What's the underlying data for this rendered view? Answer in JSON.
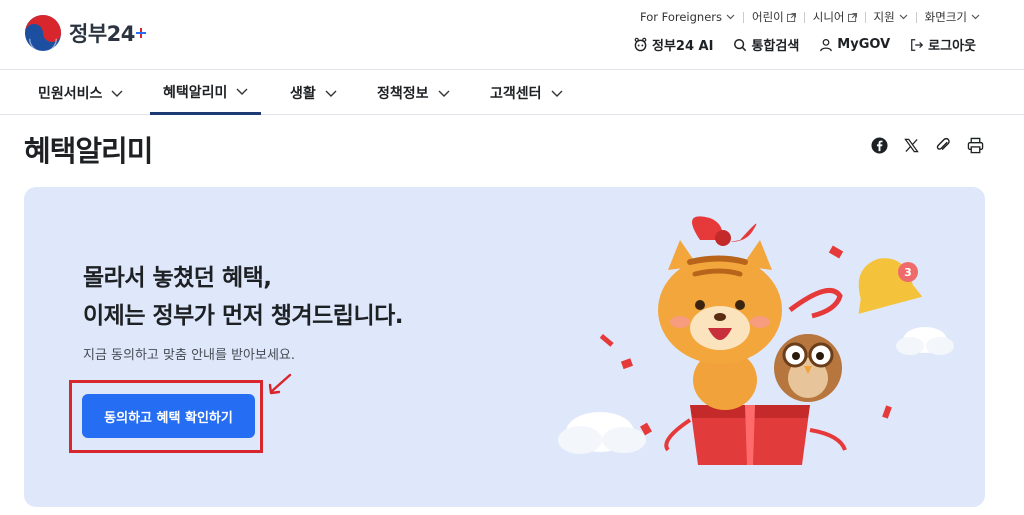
{
  "header": {
    "logo": {
      "text": "정부24",
      "emblem_icon": "taegeuk-emblem-icon"
    },
    "utility": [
      {
        "label": "For Foreigners",
        "icon": "chevron-down-icon"
      },
      {
        "label": "어린이",
        "icon": "external-link-icon"
      },
      {
        "label": "시니어",
        "icon": "external-link-icon"
      },
      {
        "label": "지원",
        "icon": "chevron-down-icon"
      },
      {
        "label": "화면크기",
        "icon": "chevron-down-icon"
      }
    ],
    "main_links": [
      {
        "label": "정부24 AI",
        "icon": "ai-bot-icon"
      },
      {
        "label": "통합검색",
        "icon": "search-icon"
      },
      {
        "label": "MyGOV",
        "icon": "user-icon"
      },
      {
        "label": "로그아웃",
        "icon": "logout-icon"
      }
    ]
  },
  "gnb": {
    "items": [
      {
        "label": "민원서비스",
        "active": false
      },
      {
        "label": "혜택알리미",
        "active": true
      },
      {
        "label": "생활",
        "active": false
      },
      {
        "label": "정책정보",
        "active": false
      },
      {
        "label": "고객센터",
        "active": false
      }
    ]
  },
  "page": {
    "title": "혜택알리미",
    "share_icons": [
      "facebook-icon",
      "x-icon",
      "link-icon",
      "print-icon"
    ]
  },
  "hero": {
    "headline_line1": "몰라서 놓쳤던 혜택,",
    "headline_line2": "이제는 정부가 먼저 챙겨드립니다.",
    "subtext": "지금 동의하고 맞춤 안내를 받아보세요.",
    "cta_label": "동의하고 혜택 확인하기",
    "bell_badge": "3"
  },
  "colors": {
    "primary": "#256ef4",
    "hero_bg": "#dfe8fb",
    "annotation_red": "#d8262d",
    "nav_active": "#1d3b73"
  }
}
